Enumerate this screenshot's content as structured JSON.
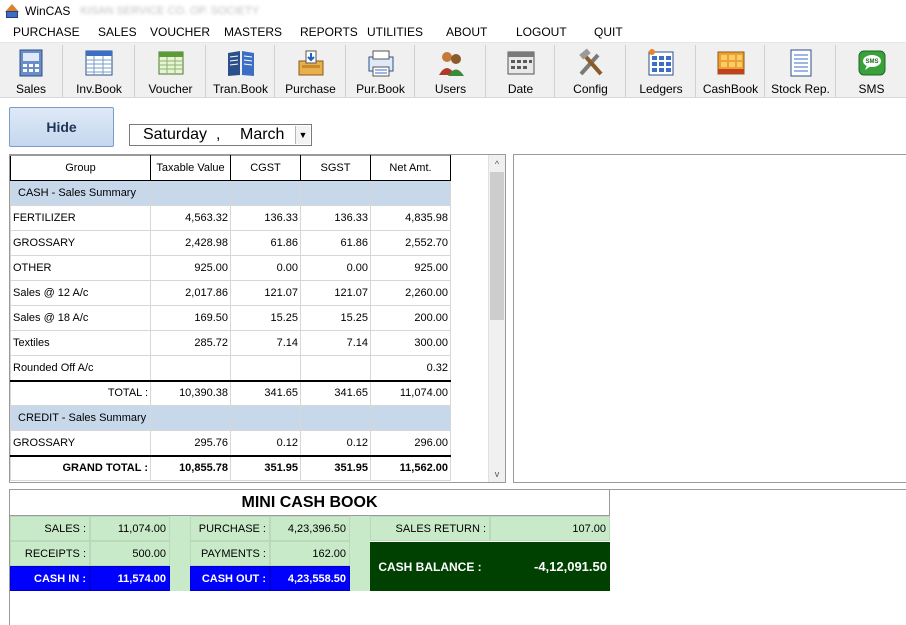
{
  "window": {
    "title": "WinCAS",
    "subtitle_blurred": "KISAN SERVICE CO. OP. SOCIETY"
  },
  "menu": [
    "PURCHASE",
    "SALES",
    "VOUCHER",
    "MASTERS",
    "REPORTS",
    "UTILITIES",
    "ABOUT",
    "LOGOUT",
    "QUIT"
  ],
  "toolbar": [
    {
      "label": "Sales",
      "icon": "sales-icon"
    },
    {
      "label": "Inv.Book",
      "icon": "invoice-book-icon"
    },
    {
      "label": "Voucher",
      "icon": "voucher-icon"
    },
    {
      "label": "Tran.Book",
      "icon": "transaction-book-icon"
    },
    {
      "label": "Purchase",
      "icon": "purchase-icon"
    },
    {
      "label": "Pur.Book",
      "icon": "purchase-book-icon"
    },
    {
      "label": "Users",
      "icon": "users-icon"
    },
    {
      "label": "Date",
      "icon": "calendar-icon"
    },
    {
      "label": "Config",
      "icon": "tools-icon"
    },
    {
      "label": "Ledgers",
      "icon": "ledgers-icon"
    },
    {
      "label": "CashBook",
      "icon": "cashbook-icon"
    },
    {
      "label": "Stock Rep.",
      "icon": "stock-report-icon"
    },
    {
      "label": "SMS",
      "icon": "sms-icon"
    }
  ],
  "hide_button": "Hide",
  "date": {
    "day": "Saturday",
    "separator": ",",
    "month": "March"
  },
  "grid": {
    "columns": [
      "Group",
      "Taxable Value",
      "CGST",
      "SGST",
      "Net Amt."
    ],
    "rows": [
      {
        "type": "section",
        "label": "CASH - Sales Summary"
      },
      {
        "type": "data",
        "cells": [
          "FERTILIZER",
          "4,563.32",
          "136.33",
          "136.33",
          "4,835.98"
        ]
      },
      {
        "type": "data",
        "cells": [
          "GROSSARY",
          "2,428.98",
          "61.86",
          "61.86",
          "2,552.70"
        ]
      },
      {
        "type": "data",
        "cells": [
          "OTHER",
          "925.00",
          "0.00",
          "0.00",
          "925.00"
        ]
      },
      {
        "type": "data",
        "cells": [
          "Sales @ 12 A/c",
          "2,017.86",
          "121.07",
          "121.07",
          "2,260.00"
        ]
      },
      {
        "type": "data",
        "cells": [
          "Sales @ 18 A/c",
          "169.50",
          "15.25",
          "15.25",
          "200.00"
        ]
      },
      {
        "type": "data",
        "cells": [
          "Textiles",
          "285.72",
          "7.14",
          "7.14",
          "300.00"
        ]
      },
      {
        "type": "data",
        "cells": [
          "Rounded Off A/c",
          "",
          "",
          "",
          "0.32"
        ]
      },
      {
        "type": "total",
        "cells": [
          "TOTAL :",
          "10,390.38",
          "341.65",
          "341.65",
          "11,074.00"
        ]
      },
      {
        "type": "section",
        "label": "CREDIT - Sales Summary"
      },
      {
        "type": "data",
        "cells": [
          "GROSSARY",
          "295.76",
          "0.12",
          "0.12",
          "296.00"
        ]
      },
      {
        "type": "grand",
        "cells": [
          "GRAND TOTAL :",
          "10,855.78",
          "351.95",
          "351.95",
          "11,562.00"
        ]
      }
    ]
  },
  "cashbook": {
    "title": "MINI CASH BOOK",
    "sales_label": "SALES :",
    "sales_value": "11,074.00",
    "receipts_label": "RECEIPTS :",
    "receipts_value": "500.00",
    "cash_in_label": "CASH IN :",
    "cash_in_value": "11,574.00",
    "purchase_label": "PURCHASE :",
    "purchase_value": "4,23,396.50",
    "payments_label": "PAYMENTS :",
    "payments_value": "162.00",
    "cash_out_label": "CASH OUT :",
    "cash_out_value": "4,23,558.50",
    "sales_return_label": "SALES RETURN :",
    "sales_return_value": "107.00",
    "cash_balance_label": "CASH BALANCE :",
    "cash_balance_value": "-4,12,091.50"
  },
  "colors": {
    "section_bg": "#c6d8ea",
    "cashbook_green": "#c9eac9",
    "cash_blue": "#0000ff",
    "balance_dark_green": "#004000"
  }
}
